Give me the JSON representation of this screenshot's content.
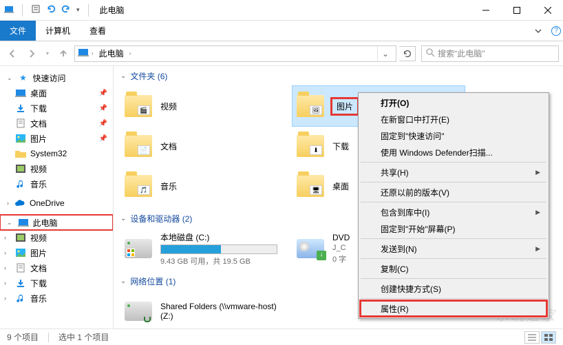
{
  "titlebar": {
    "title": "此电脑"
  },
  "ribbon": {
    "file": "文件",
    "computer": "计算机",
    "view": "查看"
  },
  "address": {
    "location": "此电脑",
    "search_placeholder": "搜索\"此电脑\""
  },
  "sidebar": {
    "quick_access": {
      "label": "快速访问"
    },
    "quick_items": [
      {
        "label": "桌面",
        "icon": "desktop"
      },
      {
        "label": "下载",
        "icon": "download"
      },
      {
        "label": "文档",
        "icon": "document"
      },
      {
        "label": "图片",
        "icon": "picture"
      },
      {
        "label": "System32",
        "icon": "folder"
      },
      {
        "label": "视频",
        "icon": "video"
      },
      {
        "label": "音乐",
        "icon": "music"
      }
    ],
    "onedrive": {
      "label": "OneDrive"
    },
    "this_pc": {
      "label": "此电脑",
      "highlight": true
    },
    "this_pc_children": [
      {
        "label": "视频",
        "icon": "video"
      },
      {
        "label": "图片",
        "icon": "picture"
      },
      {
        "label": "文档",
        "icon": "document"
      },
      {
        "label": "下载",
        "icon": "download"
      },
      {
        "label": "音乐",
        "icon": "music"
      }
    ]
  },
  "sections": {
    "folders": {
      "heading": "文件夹 (6)",
      "items": [
        {
          "label": "视频",
          "glyph": "🎬"
        },
        {
          "label": "图片",
          "glyph": "🖼",
          "selected": true,
          "highlight": true
        },
        {
          "label": "文档",
          "glyph": "📄"
        },
        {
          "label": "下载",
          "glyph": "⬇"
        },
        {
          "label": "音乐",
          "glyph": "🎵"
        },
        {
          "label": "桌面",
          "glyph": "🖥"
        }
      ]
    },
    "drives": {
      "heading": "设备和驱动器 (2)",
      "items": [
        {
          "label": "本地磁盘 (C:)",
          "sub": "9.43 GB 可用，共 19.5 GB",
          "fill_pct": 52,
          "type": "hdd"
        },
        {
          "label": "DVD",
          "sub_a": "J_C",
          "sub_b": "0 字",
          "type": "dvd"
        }
      ]
    },
    "network": {
      "heading": "网络位置 (1)",
      "items": [
        {
          "label": "Shared Folders (\\\\vmware-host)",
          "sub": "(Z:)"
        }
      ]
    }
  },
  "context_menu": {
    "items": [
      {
        "label": "打开(O)",
        "bold": true
      },
      {
        "label": "在新窗口中打开(E)"
      },
      {
        "label": "固定到\"快速访问\""
      },
      {
        "label": "使用 Windows Defender扫描..."
      },
      {
        "sep": true
      },
      {
        "label": "共享(H)",
        "submenu": true
      },
      {
        "sep": true
      },
      {
        "label": "还原以前的版本(V)"
      },
      {
        "sep": true
      },
      {
        "label": "包含到库中(I)",
        "submenu": true
      },
      {
        "label": "固定到\"开始\"屏幕(P)"
      },
      {
        "sep": true
      },
      {
        "label": "发送到(N)",
        "submenu": true
      },
      {
        "sep": true
      },
      {
        "label": "复制(C)"
      },
      {
        "sep": true
      },
      {
        "label": "创建快捷方式(S)"
      },
      {
        "sep": true
      },
      {
        "label": "属性(R)",
        "highlight": true
      }
    ]
  },
  "statusbar": {
    "count": "9 个项目",
    "selected": "选中 1 个项目"
  },
  "watermark": "系统之家"
}
